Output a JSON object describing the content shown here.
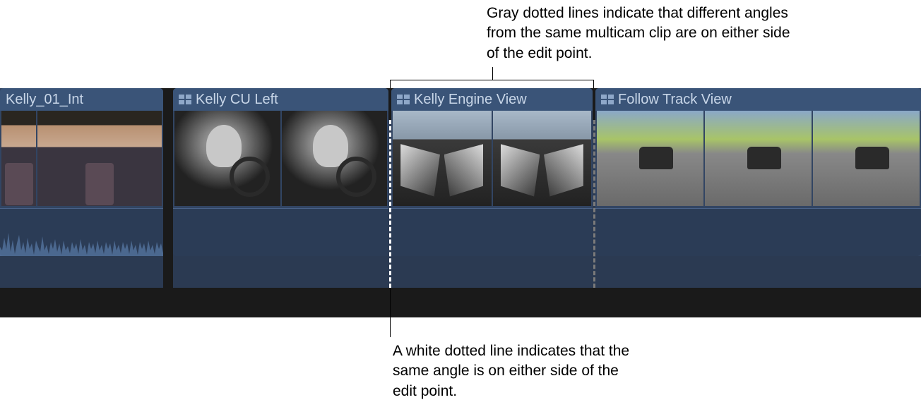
{
  "annotations": {
    "top": "Gray dotted lines indicate that different angles from the same multicam clip are on either side of the edit point.",
    "bottom": "A white dotted line indicates that the same angle is on either side of the edit point."
  },
  "clips": [
    {
      "name": "Kelly_01_Int"
    },
    {
      "name": "Kelly CU Left"
    },
    {
      "name": "Kelly Engine View"
    },
    {
      "name": "Follow Track View"
    }
  ]
}
